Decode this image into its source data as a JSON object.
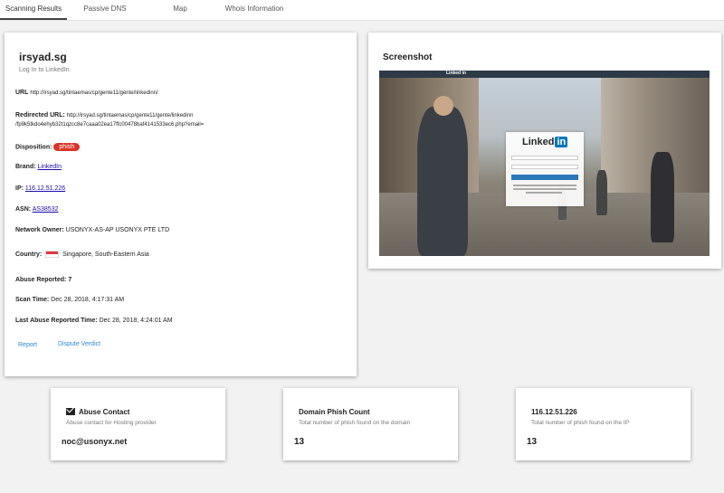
{
  "tabs": [
    {
      "label": "Scanning Results"
    },
    {
      "label": "Passive DNS"
    },
    {
      "label": "Map"
    },
    {
      "label": "Whois Information"
    }
  ],
  "result": {
    "domain": "irsyad.sg",
    "page_title": "Log In to LinkedIn",
    "url_label": "URL",
    "url": "http://irsyad.sg/tintaemas/cp/gente11/gente/linkedinn/",
    "redirected_label": "Redirected URL:",
    "redirected_url_1": "http://irsyad.sg/tintaemas/cp/gente11/gente/linkedinn",
    "redirected_url_2": "/fp9k5tkdo4ehyb32t1qzcc8e7caaa02ea17ffc00478baf4141533ec6.php?email=",
    "disposition_label": "Disposition:",
    "disposition": "phish",
    "brand_label": "Brand:",
    "brand": "LinkedIn",
    "ip_label": "IP:",
    "ip": "116.12.51.226",
    "asn_label": "ASN:",
    "asn": "AS38532",
    "network_owner_label": "Network Owner:",
    "network_owner": "USONYX-AS-AP USONYX PTE LTD",
    "country_label": "Country:",
    "country": "Singapore, South-Eastern Asia",
    "abuse_reported_label": "Abuse Reported:",
    "abuse_reported": "7",
    "scan_time_label": "Scan Time:",
    "scan_time": "Dec 28, 2018, 4:17:31 AM",
    "last_abuse_label": "Last Abuse Reported Time:",
    "last_abuse": "Dec 28, 2018, 4:24:01 AM",
    "report_label": "Report",
    "dispute_label": "Dispute Verdict"
  },
  "screenshot": {
    "title": "Screenshot",
    "bar_text": "Linked in",
    "logo_text": "Linked",
    "logo_badge": "in"
  },
  "abuse_contact": {
    "title": "Abuse Contact",
    "subtitle": "Abuse contact for Hosting provider",
    "email": "noc@usonyx.net",
    "icon": "mail-icon"
  },
  "domain_phish": {
    "title": "Domain Phish Count",
    "subtitle": "Total number of phish found on the domain",
    "value": "13"
  },
  "ip_phish": {
    "title": "116.12.51.226",
    "subtitle": "Total number of phish found on the IP",
    "value": "13"
  },
  "colors": {
    "phish_badge": "#d9342b",
    "link": "#1a0dab",
    "action": "#2b8ad8"
  }
}
